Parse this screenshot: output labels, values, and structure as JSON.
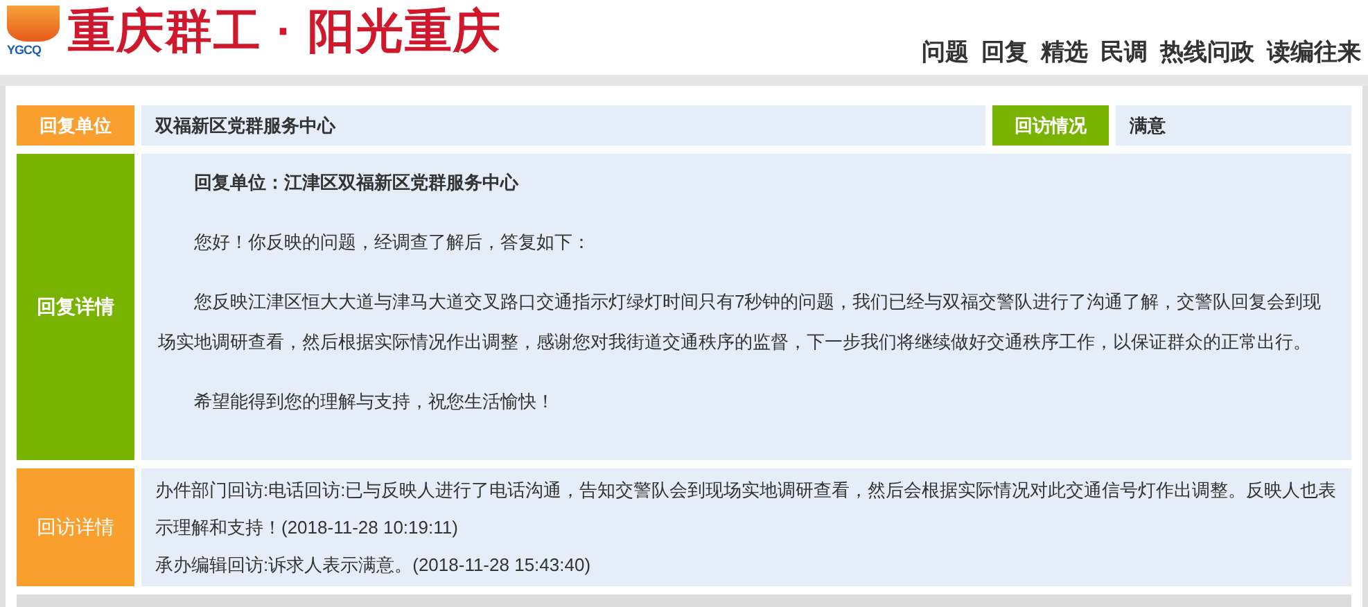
{
  "header": {
    "logo_mark": "YGCQ",
    "site_title": "重庆群工 · 阳光重庆",
    "nav": [
      {
        "label": "问题"
      },
      {
        "label": "回复"
      },
      {
        "label": "精选"
      },
      {
        "label": "民调"
      },
      {
        "label": "热线问政"
      },
      {
        "label": "读编往来"
      }
    ]
  },
  "summary": {
    "unit_label": "回复单位",
    "unit_value": "双福新区党群服务中心",
    "visit_label": "回访情况",
    "visit_value": "满意"
  },
  "reply_details": {
    "label": "回复详情",
    "paragraphs": [
      {
        "text": "回复单位：江津区双福新区党群服务中心",
        "bold": true
      },
      {
        "text": "您好！你反映的问题，经调查了解后，答复如下：",
        "bold": false
      },
      {
        "text": "您反映江津区恒大大道与津马大道交叉路口交通指示灯绿灯时间只有7秒钟的问题，我们已经与双福交警队进行了沟通了解，交警队回复会到现场实地调研查看，然后根据实际情况作出调整，感谢您对我街道交通秩序的监督，下一步我们将继续做好交通秩序工作，以保证群众的正常出行。",
        "bold": false
      },
      {
        "text": "希望能得到您的理解与支持，祝您生活愉快！",
        "bold": false
      }
    ]
  },
  "visit_details": {
    "label": "回访详情",
    "lines": [
      "办件部门回访:电话回访:已与反映人进行了电话沟通，告知交警队会到现场实地调研查看，然后会根据实际情况对此交通信号灯作出调整。反映人也表示理解和支持！(2018-11-28 10:19:11)",
      "承办编辑回访:诉求人表示满意。(2018-11-28 15:43:40)"
    ]
  }
}
